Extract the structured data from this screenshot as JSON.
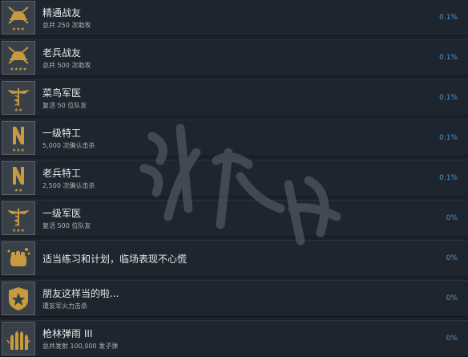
{
  "achievements": [
    {
      "title": "精通战友",
      "desc": "总共 250 次助攻",
      "percent": "0.1%",
      "icon": "helmet-crossed-swords-icon"
    },
    {
      "title": "老兵战友",
      "desc": "总共 500 次助攻",
      "percent": "0.1%",
      "icon": "helmet-crossed-swords-icon"
    },
    {
      "title": "菜鸟军医",
      "desc": "复活 50 位队友",
      "percent": "0.1%",
      "icon": "medic-caduceus-icon"
    },
    {
      "title": "一级特工",
      "desc": "5,000 次确认击杀",
      "percent": "0.1%",
      "icon": "operative-n-insignia-icon"
    },
    {
      "title": "老兵特工",
      "desc": "2,500 次确认击杀",
      "percent": "0.1%",
      "icon": "operative-n-insignia-icon"
    },
    {
      "title": "一级军医",
      "desc": "复活 500 位队友",
      "percent": "0%",
      "icon": "medic-caduceus-icon"
    },
    {
      "title": "适当练习和计划，临场表现不心慌",
      "desc": "",
      "percent": "0%",
      "icon": "fist-icon"
    },
    {
      "title": "朋友这样当的啦...",
      "desc": "遭友军火力击杀",
      "percent": "0%",
      "icon": "star-shield-icon"
    },
    {
      "title": "枪林弹雨 III",
      "desc": "总共发射 100,000 发子弹",
      "percent": "0%",
      "icon": "bullets-icon"
    }
  ],
  "colors": {
    "background": "#1b2029",
    "row": "#1f252e",
    "icon_gold": "#c79a3e",
    "percent": "#4a97d0"
  }
}
